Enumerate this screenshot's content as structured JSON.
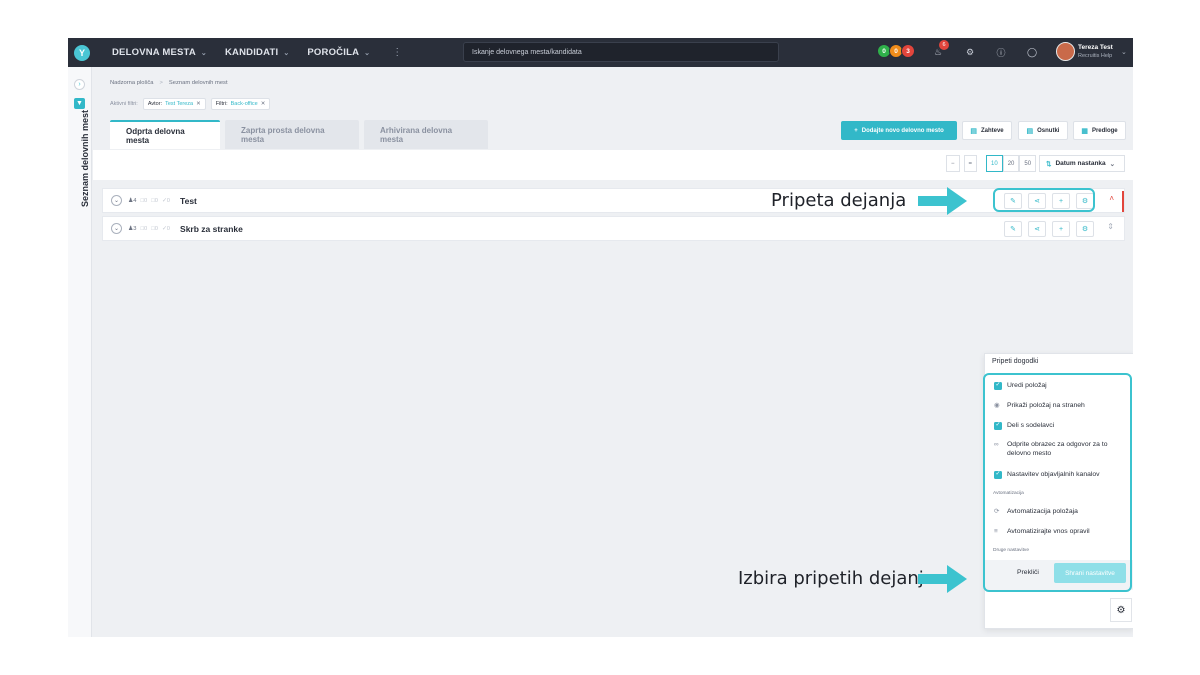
{
  "nav": {
    "items": [
      "DELOVNA MESTA",
      "KANDIDATI",
      "POROČILA"
    ],
    "more": "⋮",
    "search_placeholder": "Iskanje delovnega mesta/kandidata",
    "status_counts": [
      {
        "value": "0",
        "color": "#2fb04a"
      },
      {
        "value": "0",
        "color": "#f08c1a"
      },
      {
        "value": "3",
        "color": "#e2453c"
      }
    ],
    "bell_badge": "6",
    "user_name": "Tereza Test",
    "user_org": "Recruitis Help"
  },
  "sidebar": {
    "label": "Seznam delovnih mest"
  },
  "breadcrumb": {
    "home": "Nadzorna plošča",
    "separator": ">",
    "current": "Seznam delovnih mest"
  },
  "filters": {
    "label": "Aktivni filtri:",
    "chips": [
      {
        "key": "Avtor:",
        "value": "Test Tereza"
      },
      {
        "key": "Filtri:",
        "value": "Back-office"
      }
    ]
  },
  "tabs": [
    "Odprta delovna mesta",
    "Zaprta prosta delovna mesta",
    "Arhivirana delovna mesta"
  ],
  "toolbar": {
    "add_job": "Dodajte novo delovno mesto",
    "requests": "Zahteve",
    "drafts": "Osnutki",
    "templates": "Predloge"
  },
  "view": {
    "minus": "−",
    "equals": "=",
    "page_sizes": [
      "10",
      "20",
      "50"
    ],
    "selected_page_size": "10",
    "sort_label": "Datum nastanka"
  },
  "rows": [
    {
      "title": "Test",
      "candidates": "4",
      "stats": [
        "0",
        "0",
        "0"
      ]
    },
    {
      "title": "Skrb za stranke",
      "candidates": "3",
      "stats": [
        "0",
        "0",
        "0"
      ]
    }
  ],
  "annotations": {
    "actions": "Pripeta dejanja",
    "picker": "Izbira pripetih dejanj"
  },
  "panel": {
    "title": "Pripeti dogodki",
    "items": [
      {
        "label": "Uredi položaj",
        "checked": true
      },
      {
        "label": "Prikaži položaj na straneh",
        "checked": false
      },
      {
        "label": "Deli s sodelavci",
        "checked": true
      },
      {
        "label": "Odprite obrazec za odgovor za to delovno mesto",
        "checked": false
      },
      {
        "label": "Nastavitev objavljalnih kanalov",
        "checked": true
      }
    ],
    "section_automation": "Avtomatizacija",
    "automation_items": [
      "Avtomatizacija položaja",
      "Avtomatizirajte vnos opravil"
    ],
    "section_other": "Druge nastavitve",
    "cancel": "Prekliči",
    "save": "Shrani nastavitve"
  },
  "colors": {
    "accent": "#32b8c8",
    "highlight": "#3cc3cf",
    "topbar": "#2a2f3a",
    "danger": "#e2453c"
  }
}
